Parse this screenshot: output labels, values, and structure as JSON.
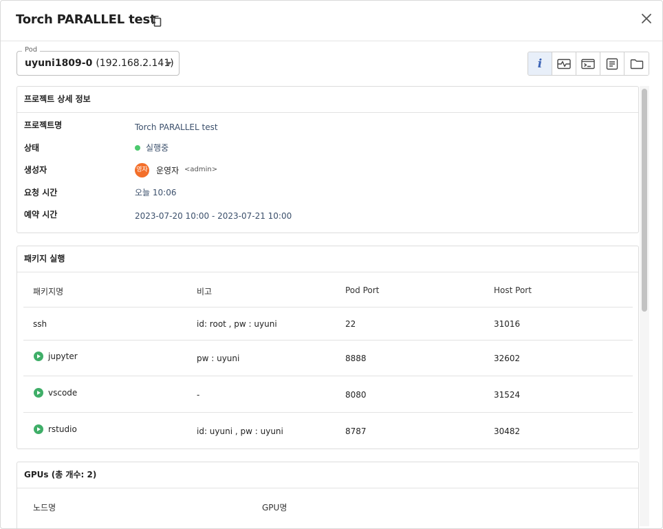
{
  "dialog": {
    "title": "Torch PARALLEL test"
  },
  "pod": {
    "legend": "Pod",
    "name": "uyuni1809-0",
    "ip": "(192.168.2.141)"
  },
  "toolbar": {
    "buttons": [
      "info-icon",
      "monitor-icon",
      "terminal-icon",
      "log-icon",
      "folder-icon"
    ],
    "active_index": 0,
    "info_glyph": "i"
  },
  "details": {
    "heading": "프로젝트 상세 정보",
    "project_name_label": "프로젝트명",
    "project_name": "Torch PARALLEL test",
    "status_label": "상태",
    "status": "실행중",
    "status_color": "#4cc96e",
    "creator_label": "생성자",
    "creator_avatar": "영자",
    "creator_avatar_color": "#f36f2a",
    "creator_name": "운영자",
    "creator_id": "<admin>",
    "request_time_label": "요청 시간",
    "request_time": "오늘 10:06",
    "reservation_label": "예약 시간",
    "reservation": "2023-07-20 10:00 - 2023-07-21 10:00"
  },
  "packages": {
    "heading": "패키지 실행",
    "columns": [
      "패키지명",
      "비고",
      "Pod Port",
      "Host Port"
    ],
    "rows": [
      {
        "name": "ssh",
        "note": "id: root , pw : uyuni",
        "pod_port": "22",
        "host_port": "31016",
        "runnable": false
      },
      {
        "name": "jupyter",
        "note": "pw : uyuni",
        "pod_port": "8888",
        "host_port": "32602",
        "runnable": true
      },
      {
        "name": "vscode",
        "note": "-",
        "pod_port": "8080",
        "host_port": "31524",
        "runnable": true
      },
      {
        "name": "rstudio",
        "note": "id: uyuni , pw : uyuni",
        "pod_port": "8787",
        "host_port": "30482",
        "runnable": true
      }
    ]
  },
  "gpus": {
    "heading": "GPUs (총 개수: 2)",
    "columns": [
      "노드명",
      "GPU명"
    ]
  },
  "colors": {
    "accent": "#3a62b5",
    "run_button": "#3fae68"
  }
}
